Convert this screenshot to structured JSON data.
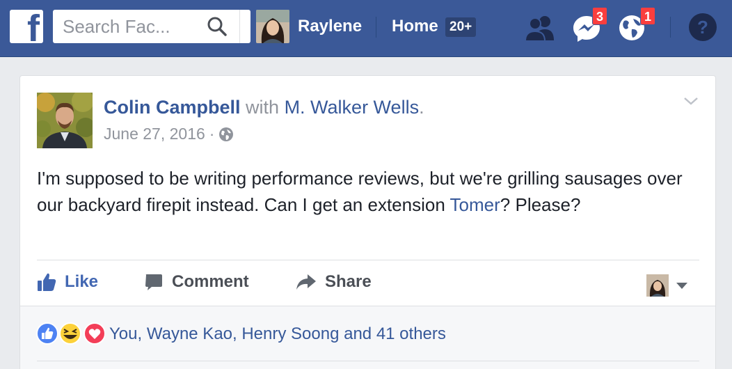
{
  "topbar": {
    "search_placeholder": "Search Fac...",
    "profile_name": "Raylene",
    "home_label": "Home",
    "home_count": "20+",
    "messages_badge": "3",
    "notifications_badge": "1",
    "colors": {
      "bar": "#3b5998",
      "badge": "#fa3e3e"
    }
  },
  "post": {
    "author": "Colin Campbell",
    "with_word": "with",
    "tagged": "M. Walker Wells",
    "period": ".",
    "date": "June 27, 2016",
    "dot": "·",
    "text_part1": "I'm supposed to be writing performance reviews, but we're grilling sausages over our backyard firepit instead. Can I get an extension ",
    "mention": "Tomer",
    "text_part2": "? Please?",
    "actions": {
      "like": "Like",
      "comment": "Comment",
      "share": "Share"
    },
    "reactions_text": "You, Wayne Kao, Henry Soong and 41 others",
    "icons": [
      "facebook-logo",
      "search-icon",
      "friends-icon",
      "messenger-icon",
      "globe-icon",
      "help-icon",
      "globe-icon",
      "chevron-down-icon",
      "like-icon",
      "comment-icon",
      "share-icon",
      "like-reaction",
      "haha-reaction",
      "love-reaction"
    ]
  }
}
